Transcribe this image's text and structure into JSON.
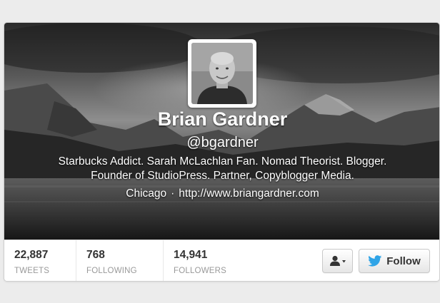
{
  "profile": {
    "name": "Brian Gardner",
    "handle": "@bgardner",
    "bio_line1": "Starbucks Addict. Sarah McLachlan Fan. Nomad Theorist. Blogger.",
    "bio_line2": "Founder of StudioPress. Partner, Copyblogger Media.",
    "location": "Chicago",
    "separator": "·",
    "url": "http://www.briangardner.com"
  },
  "stats": [
    {
      "value": "22,887",
      "label": "TWEETS"
    },
    {
      "value": "768",
      "label": "FOLLOWING"
    },
    {
      "value": "14,941",
      "label": "FOLLOWERS"
    }
  ],
  "actions": {
    "user_menu_icon": "user-dropdown-icon",
    "follow_label": "Follow",
    "follow_icon": "twitter-bird-icon"
  },
  "colors": {
    "twitter_blue": "#2fa4e7",
    "page_bg": "#ececec"
  }
}
